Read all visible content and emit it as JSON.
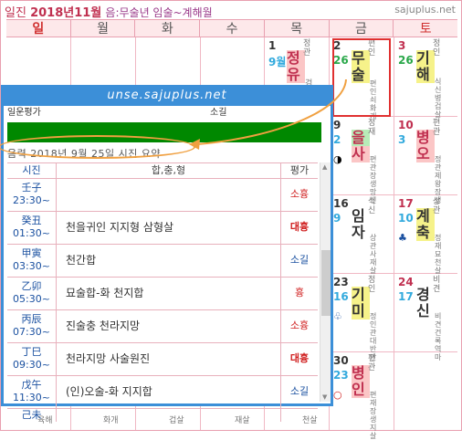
{
  "header": {
    "prefix": "일진",
    "year_month": "2018년11월",
    "lunar": "음:무술년 임술~계해월"
  },
  "brand": "sajuplus.net",
  "weekdays": [
    "일",
    "월",
    "화",
    "수",
    "목",
    "금",
    "토"
  ],
  "cells": {
    "thu1": {
      "day": "1",
      "lunar": "9월",
      "gz": [
        "정",
        "유"
      ],
      "ten": "정관",
      "vert": "검재"
    },
    "fri2": {
      "day": "2",
      "lunar": "26",
      "gz": [
        "무",
        "술"
      ],
      "ten": "편인",
      "vert": "편인쇠화개"
    },
    "sat3": {
      "day": "3",
      "lunar": "26",
      "gz": [
        "기",
        "해"
      ],
      "ten": "정인",
      "vert": "식신병겁살"
    },
    "fri9": {
      "day": "9",
      "lunar": "2",
      "gz": [
        "을",
        "사"
      ],
      "ten": "정재",
      "vert": "편관장생망신"
    },
    "sat10": {
      "day": "10",
      "lunar": "3",
      "gz": [
        "병",
        "오"
      ],
      "ten": "편관",
      "vert": "정관제왕장성"
    },
    "fri16": {
      "day": "16",
      "lunar": "9",
      "gz": [
        "임",
        "자"
      ],
      "ten": "식신",
      "vert": "상관사재살"
    },
    "sat17": {
      "day": "17",
      "lunar": "10",
      "gz": [
        "계",
        "축"
      ],
      "ten": "상관",
      "vert": "정재묘천살"
    },
    "fri23": {
      "day": "23",
      "lunar": "16",
      "gz": [
        "기",
        "미"
      ],
      "ten": "정인",
      "vert": "정인관대반안"
    },
    "sat24": {
      "day": "24",
      "lunar": "17",
      "gz": [
        "경",
        "신"
      ],
      "ten": "비견",
      "vert": "비견건록역마"
    },
    "fri30": {
      "day": "30",
      "lunar": "23",
      "gz": [
        "병",
        "인"
      ],
      "ten": "편관",
      "vert": "편재장생지살"
    }
  },
  "popup": {
    "title": "unse.sajuplus.net",
    "partial_left": "일운평가",
    "partial_right": "소길",
    "summary": "음력 2018년 9월 25일 시진 요약",
    "headers": [
      "시진",
      "합,충,형",
      "평가"
    ],
    "rows": [
      {
        "branch": "壬子",
        "time": "23:30~",
        "desc": "",
        "rating": "소흉"
      },
      {
        "branch": "癸丑",
        "time": "01:30~",
        "desc": "천을귀인 지지형 삼형살",
        "rating": "대흉"
      },
      {
        "branch": "甲寅",
        "time": "03:30~",
        "desc": "천간합",
        "rating": "소길"
      },
      {
        "branch": "乙卯",
        "time": "05:30~",
        "desc": "묘술합-화 천지합",
        "rating": "흉"
      },
      {
        "branch": "丙辰",
        "time": "07:30~",
        "desc": "진술충 천라지망",
        "rating": "소흉"
      },
      {
        "branch": "丁巳",
        "time": "09:30~",
        "desc": "천라지망 사술원진",
        "rating": "대흉"
      },
      {
        "branch": "戊午",
        "time": "11:30~",
        "desc": "(인)오술-화 지지합",
        "rating": "소길"
      },
      {
        "branch": "己未",
        "time": "",
        "desc": "",
        "rating": ""
      }
    ]
  },
  "bottom_labels": [
    "육해",
    "화개",
    "겁살",
    "재살",
    "천살"
  ],
  "colors": {
    "accent": "#3c8fd8",
    "grid": "#f0b8c4",
    "green_bar": "#008800",
    "ellipse": "#f0a040"
  }
}
